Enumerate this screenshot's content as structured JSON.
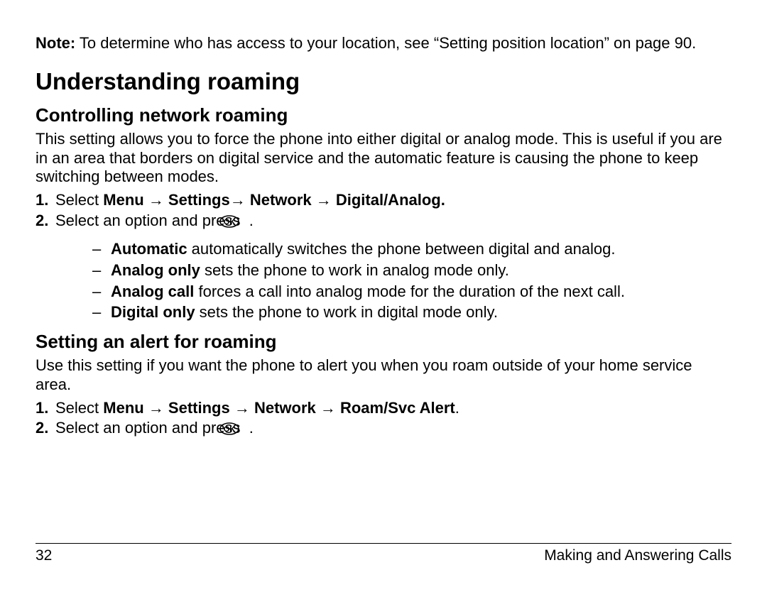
{
  "note": {
    "label": "Note:",
    "text": " To determine who has access to your location, see “Setting position location” on page 90."
  },
  "h1": "Understanding roaming",
  "section1": {
    "heading": "Controlling network roaming",
    "para": "This setting allows you to force the phone into either digital or analog mode. This is useful if you are in an area that borders on digital service and the automatic feature is causing the phone to keep switching between modes.",
    "steps": [
      {
        "num": "1.",
        "pre": "Select ",
        "bold": "Menu → Settings→ Network → Digital/Analog.",
        "post": ""
      },
      {
        "num": "2.",
        "pre": "Select an option and press ",
        "bold": "",
        "post": " ."
      }
    ],
    "options": [
      {
        "bold": "Automatic",
        "rest": " automatically switches the phone between digital and analog."
      },
      {
        "bold": "Analog only",
        "rest": " sets the phone to work in analog mode only."
      },
      {
        "bold": "Analog call",
        "rest": " forces a call into analog mode for the duration of the next call."
      },
      {
        "bold": "Digital only",
        "rest": " sets the phone to work in digital mode only."
      }
    ]
  },
  "section2": {
    "heading": "Setting an alert for roaming",
    "para": "Use this setting if you want the phone to alert you when you roam outside of your home service area.",
    "steps": [
      {
        "num": "1.",
        "pre": "Select ",
        "bold": "Menu → Settings → Network → Roam/Svc Alert",
        "post": "."
      },
      {
        "num": "2.",
        "pre": "Select an option and press ",
        "bold": "",
        "post": " ."
      }
    ]
  },
  "footer": {
    "page": "32",
    "chapter": "Making and Answering Calls"
  }
}
